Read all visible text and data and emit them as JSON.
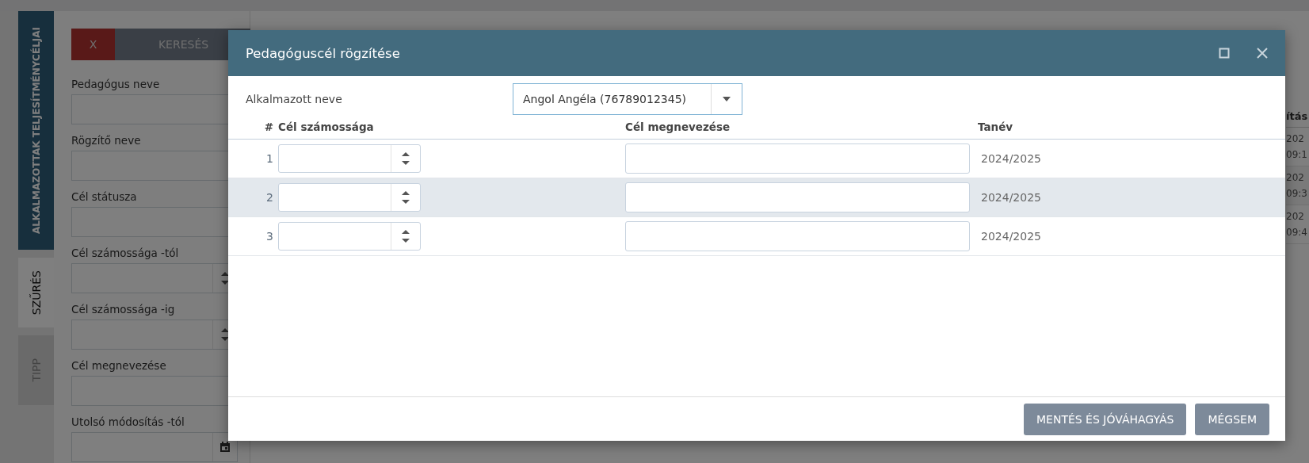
{
  "sidebar_tabs": [
    {
      "label": "ALKALMAZOTTAK TELJESÍTMÉNYCÉLJAI",
      "kind": "module",
      "selected": false,
      "disabled": false
    },
    {
      "label": "SZŰRÉS",
      "kind": "tab",
      "selected": true,
      "disabled": false
    },
    {
      "label": "TIPP",
      "kind": "tab",
      "selected": false,
      "disabled": true
    }
  ],
  "filter": {
    "buttons": [
      {
        "label": "X",
        "kind": "clear"
      },
      {
        "label": "KERESÉS",
        "kind": "search"
      }
    ],
    "fields": [
      {
        "label": "Pedagógus neve",
        "kind": "text"
      },
      {
        "label": "Rögzítő neve",
        "kind": "text"
      },
      {
        "label": "Cél státusza",
        "kind": "text"
      },
      {
        "label": "Cél számossága -tól",
        "kind": "number"
      },
      {
        "label": "Cél számossága -ig",
        "kind": "number"
      },
      {
        "label": "Cél megnevezése",
        "kind": "text"
      },
      {
        "label": "Utolsó módosítás -tól",
        "kind": "date"
      }
    ]
  },
  "background_table": {
    "column_header": "ítás",
    "rows": [
      [
        "202",
        "09:1"
      ],
      [
        "202",
        "09:3"
      ],
      [
        "202",
        "09:4"
      ]
    ]
  },
  "modal": {
    "title": "Pedagóguscél rögzítése",
    "employee": {
      "label": "Alkalmazott neve",
      "value": "Angol Angéla (76789012345)"
    },
    "columns": [
      "#",
      "Cél számossága",
      "Cél megnevezése",
      "Tanév"
    ],
    "rows": [
      {
        "number": "1",
        "school_year": "2024/2025",
        "highlighted": false
      },
      {
        "number": "2",
        "school_year": "2024/2025",
        "highlighted": true
      },
      {
        "number": "3",
        "school_year": "2024/2025",
        "highlighted": false
      }
    ],
    "buttons": [
      {
        "label": "MENTÉS ÉS JÓVÁHAGYÁS"
      },
      {
        "label": "MÉGSEM"
      }
    ]
  }
}
